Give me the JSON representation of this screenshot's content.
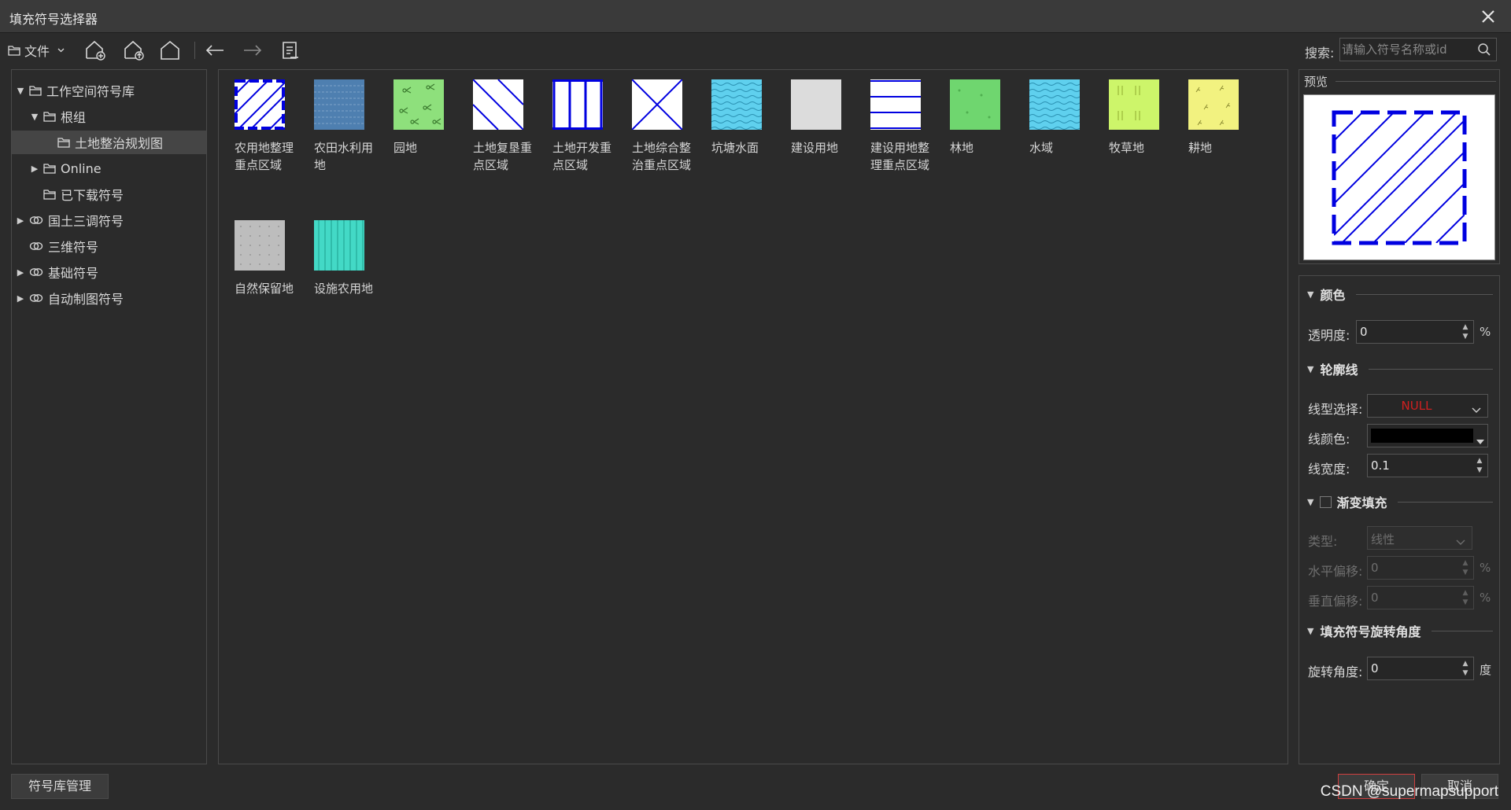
{
  "window": {
    "title": "填充符号选择器",
    "close_icon": "close-icon"
  },
  "toolbar": {
    "file_label": "文件",
    "search_label": "搜索:",
    "search_placeholder": "请输入符号名称或id"
  },
  "tree": {
    "items": [
      {
        "label": "工作空间符号库",
        "expanded": true,
        "icon": "folder-icon"
      },
      {
        "label": "根组",
        "expanded": true,
        "icon": "folder-icon"
      },
      {
        "label": "土地整治规划图",
        "selected": true,
        "icon": "folder-icon"
      },
      {
        "label": "Online",
        "expanded": false,
        "icon": "folder-icon"
      },
      {
        "label": "已下载符号",
        "icon": "folder-icon"
      },
      {
        "label": "国土三调符号",
        "expanded": false,
        "icon": "link-icon"
      },
      {
        "label": "三维符号",
        "icon": "link-icon"
      },
      {
        "label": "基础符号",
        "expanded": false,
        "icon": "link-icon"
      },
      {
        "label": "自动制图符号",
        "expanded": false,
        "icon": "link-icon"
      }
    ]
  },
  "symbols": [
    {
      "label": "农用地整理重点区域",
      "pattern": "blue-dashed-diagonal"
    },
    {
      "label": "农田水利用地",
      "pattern": "steel-blue-lines"
    },
    {
      "label": "园地",
      "pattern": "green-scissors"
    },
    {
      "label": "土地复垦重点区域",
      "pattern": "white-blue-diagonal"
    },
    {
      "label": "土地开发重点区域",
      "pattern": "white-blue-vertical"
    },
    {
      "label": "土地综合整治重点区域",
      "pattern": "white-blue-x"
    },
    {
      "label": "坑塘水面",
      "pattern": "cyan-waves"
    },
    {
      "label": "建设用地",
      "pattern": "light-gray"
    },
    {
      "label": "建设用地整理重点区域",
      "pattern": "white-blue-horizontal"
    },
    {
      "label": "林地",
      "pattern": "green-dots"
    },
    {
      "label": "水域",
      "pattern": "cyan-waves-2"
    },
    {
      "label": "牧草地",
      "pattern": "yellow-green-grass"
    },
    {
      "label": "耕地",
      "pattern": "yellow-sprouts"
    },
    {
      "label": "自然保留地",
      "pattern": "gray-dots"
    },
    {
      "label": "设施农用地",
      "pattern": "turquoise-stripes"
    }
  ],
  "preview": {
    "label": "预览"
  },
  "props": {
    "color": {
      "title": "颜色",
      "transparency_label": "透明度:",
      "transparency": "0",
      "unit": "%"
    },
    "outline": {
      "title": "轮廓线",
      "linetype_label": "线型选择:",
      "linetype": "NULL",
      "linecolor_label": "线颜色:",
      "linecolor": "#000000",
      "linewidth_label": "线宽度:",
      "linewidth": "0.1"
    },
    "gradient": {
      "title": "渐变填充",
      "enabled": false,
      "type_label": "类型:",
      "type": "线性",
      "hoffset_label": "水平偏移:",
      "hoffset": "0",
      "voffset_label": "垂直偏移:",
      "voffset": "0",
      "unit": "%"
    },
    "rotation": {
      "title": "填充符号旋转角度",
      "angle_label": "旋转角度:",
      "angle": "0",
      "unit": "度"
    }
  },
  "buttons": {
    "manage": "符号库管理",
    "ok": "确定",
    "cancel": "取消"
  },
  "watermark": "CSDN @supermapsupport",
  "colors": {
    "accent_blue": "#0000e0",
    "null_red": "#d02020",
    "ok_border": "#d04040"
  }
}
